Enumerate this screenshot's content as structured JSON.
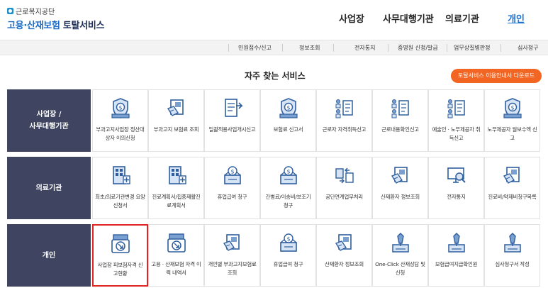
{
  "header": {
    "org": "근로복지공단",
    "title_a": "고용·",
    "title_b": "산재보험",
    "title_c": " 토탈서비스",
    "nav": [
      "사업장",
      "사무대행기관",
      "의료기관",
      "개인"
    ]
  },
  "subnav": [
    "민원접수/신고",
    "정보조회",
    "전자통지",
    "증명원 신청/발급",
    "업무상질병판정",
    "심사청구"
  ],
  "section": {
    "title": "자주 찾는 서비스",
    "guide_button": "토탈서비스 이용안내서 다운로드"
  },
  "rows": [
    {
      "label_1": "사업장 /",
      "label_2": "사무대행기관",
      "items": [
        {
          "label": "부과고지사업장 정산대상자 이의신청",
          "icon": "shield-coin-icon"
        },
        {
          "label": "부과고지 보험료 조회",
          "icon": "document-search-icon"
        },
        {
          "label": "일괄적용사업개시신고",
          "icon": "document-arrow-icon"
        },
        {
          "label": "보험료 신고서",
          "icon": "shield-coin-icon"
        },
        {
          "label": "근로자 자격취득신고",
          "icon": "people-checklist-icon"
        },
        {
          "label": "근로내용확인신고",
          "icon": "people-checklist-icon"
        },
        {
          "label": "예술인 · 노무제공자 취득신고",
          "icon": "people-checklist-icon"
        },
        {
          "label": "노무제공자 월보수액 신고",
          "icon": "shield-coin-icon"
        }
      ]
    },
    {
      "label_1": "의료기관",
      "label_2": "",
      "items": [
        {
          "label": "최초/의료기관변경 요양신청서",
          "icon": "hospital-building-icon"
        },
        {
          "label": "진료계획서/집중재활진료계획서",
          "icon": "hospital-building-icon"
        },
        {
          "label": "휴업급여 청구",
          "icon": "coin-box-icon"
        },
        {
          "label": "간병료/이송비/보조기 청구",
          "icon": "coin-box-icon"
        },
        {
          "label": "공단연계업무처리",
          "icon": "transfer-icon"
        },
        {
          "label": "산재환자 정보조회",
          "icon": "document-search-icon"
        },
        {
          "label": "전자통지",
          "icon": "monitor-search-icon"
        },
        {
          "label": "진료비/약제비청구목록",
          "icon": "document-search-icon"
        }
      ]
    },
    {
      "label_1": "개인",
      "label_2": "",
      "items": [
        {
          "label": "사업장 피보험자격 신고현황",
          "icon": "document-download-icon",
          "selected": true
        },
        {
          "label": "고용 · 산재보험 자격 이력 내역서",
          "icon": "document-download-icon"
        },
        {
          "label": "개인별 부과고지보험료 조회",
          "icon": "document-search-icon"
        },
        {
          "label": "휴업급여 청구",
          "icon": "coin-box-icon"
        },
        {
          "label": "산재환자 정보조회",
          "icon": "document-search-icon"
        },
        {
          "label": "One-Click 산재상담 및 신청",
          "icon": "pen-document-icon"
        },
        {
          "label": "보험급여지급확인원",
          "icon": "pen-document-icon"
        },
        {
          "label": "심사청구서 작성",
          "icon": "pen-document-icon"
        }
      ]
    }
  ],
  "colors": {
    "row_label_bg": "#3f4560",
    "accent_orange": "#f26522",
    "nav_active": "#1a73d6",
    "icon_blue": "#3b6fb6",
    "selection_red": "#e02424"
  }
}
